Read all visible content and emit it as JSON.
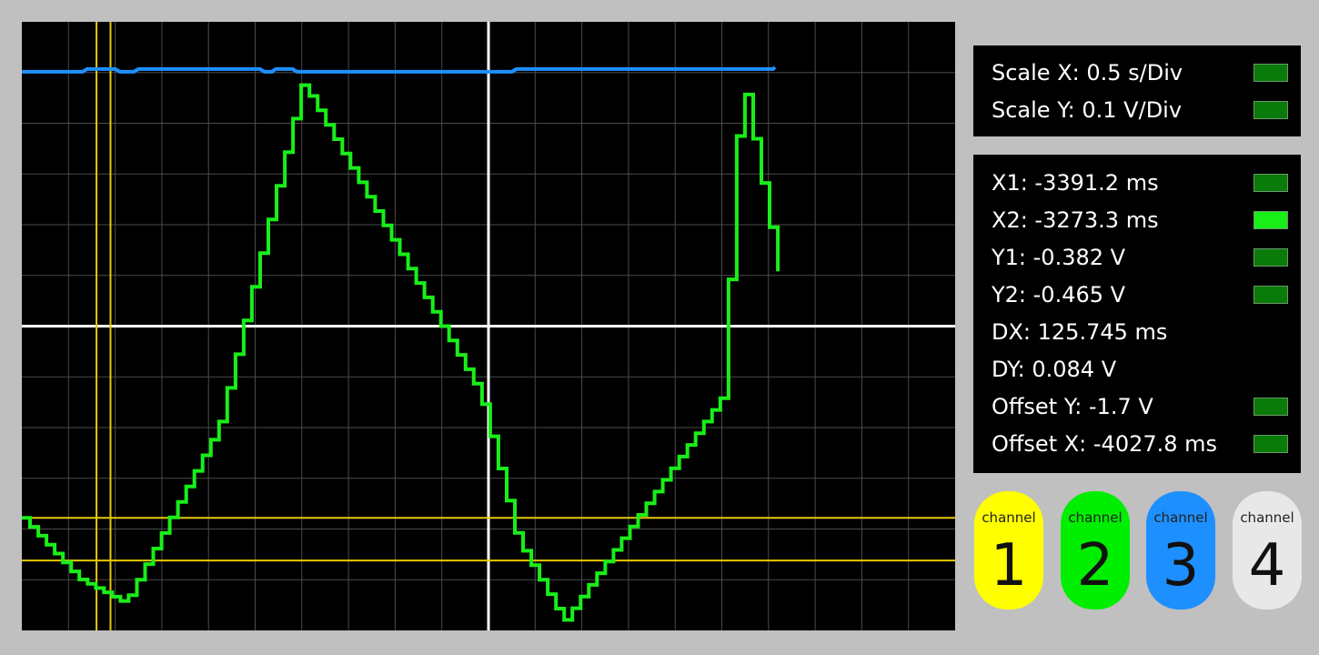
{
  "scope": {
    "background": "#000000",
    "grid_color": "#4a4a4a",
    "axis_color": "#ffffff",
    "grid_divisions": {
      "x": 20,
      "y": 12
    },
    "cursor_color": "#e6c800",
    "cursors": {
      "x1_frac": 0.08,
      "x2_frac": 0.095,
      "y1_frac": 0.815,
      "y2_frac": 0.885
    },
    "traces": {
      "channel2": {
        "color": "#19ee19",
        "description": "staircase triangle wave",
        "x": [
          0,
          0.06,
          0.11,
          0.21,
          0.28,
          0.3,
          0.49,
          0.53,
          0.58,
          0.75,
          0.77,
          0.81
        ],
        "y": [
          0.815,
          0.915,
          0.955,
          0.665,
          0.225,
          0.1,
          0.61,
          0.85,
          0.985,
          0.615,
          0.08,
          0.41
        ]
      },
      "channel3": {
        "color": "#1e8fff",
        "description": "nearly flat line near top",
        "level": 0.082
      }
    }
  },
  "scale_panel": {
    "items": [
      {
        "label": "Scale X: 0.5 s/Div",
        "swatch": "#0a7a0a"
      },
      {
        "label": "Scale Y: 0.1 V/Div",
        "swatch": "#0a7a0a"
      }
    ]
  },
  "readouts": {
    "items": [
      {
        "label": "X1: -3391.2 ms",
        "swatch": "#0a7a0a"
      },
      {
        "label": "X2: -3273.3 ms",
        "swatch": "#19ee19"
      },
      {
        "label": "Y1: -0.382 V",
        "swatch": "#0a7a0a"
      },
      {
        "label": "Y2: -0.465 V",
        "swatch": "#0a7a0a"
      },
      {
        "label": "DX: 125.745 ms",
        "swatch": ""
      },
      {
        "label": "DY: 0.084 V",
        "swatch": ""
      },
      {
        "label": "Offset Y: -1.7 V",
        "swatch": "#0a7a0a"
      },
      {
        "label": "Offset X: -4027.8 ms",
        "swatch": "#0a7a0a"
      }
    ]
  },
  "channels": [
    {
      "label": "channel",
      "number": "1",
      "color": "#ffff00"
    },
    {
      "label": "channel",
      "number": "2",
      "color": "#00ee00"
    },
    {
      "label": "channel",
      "number": "3",
      "color": "#1e8fff"
    },
    {
      "label": "channel",
      "number": "4",
      "color": "#e8e8e8"
    }
  ]
}
